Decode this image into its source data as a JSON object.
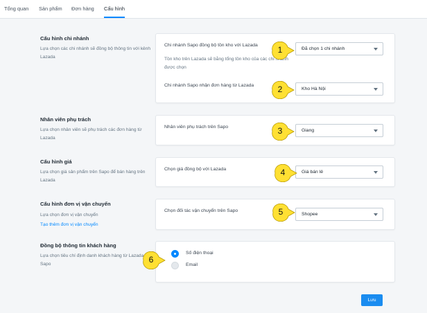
{
  "tabs": [
    {
      "label": "Tổng quan"
    },
    {
      "label": "Sản phẩm"
    },
    {
      "label": "Đơn hàng"
    },
    {
      "label": "Cấu hình"
    }
  ],
  "sections": {
    "branch": {
      "title": "Cấu hình chi nhánh",
      "desc": "Lựa chọn các chi nhánh sẽ đồng bộ thông tin với kênh Lazada",
      "field1_label": "Chi nhánh Sapo đồng bộ tồn kho với Lazada",
      "field1_note": "Tồn kho trên Lazada sẽ bằng tổng tồn kho của các chi nhánh được chọn",
      "field1_value": "Đã chọn 1 chi nhánh",
      "field2_label": "Chi nhánh Sapo nhận đơn hàng từ Lazada",
      "field2_value": "Kho Hà Nội"
    },
    "staff": {
      "title": "Nhân viên phụ trách",
      "desc": "Lựa chọn nhân viên sẽ phụ trách các đơn hàng từ Lazada",
      "field_label": "Nhân viên phụ trách trên Sapo",
      "field_value": "Giang"
    },
    "price": {
      "title": "Cấu hình giá",
      "desc": "Lựa chọn giá sản phẩm trên Sapo để bán hàng trên Lazada",
      "field_label": "Chọn giá đồng bộ với Lazada",
      "field_value": "Giá bán lẻ"
    },
    "shipping": {
      "title": "Cấu hình đơn vị vận chuyển",
      "desc": "Lựa chọn đơn vị vận chuyển",
      "link": "Tạo thêm đơn vị vận chuyển",
      "field_label": "Chọn đối tác vận chuyển trên Sapo",
      "field_value": "Shopee"
    },
    "customer": {
      "title": "Đồng bộ thông tin khách hàng",
      "desc": "Lựa chọn tiêu chí định danh khách hàng từ Lazada về Sapo",
      "option1": "Số điện thoại",
      "option2": "Email",
      "selected": "Số điện thoại"
    }
  },
  "callouts": [
    "1",
    "2",
    "3",
    "4",
    "5",
    "6"
  ],
  "save_label": "Lưu",
  "colors": {
    "accent": "#0088ff",
    "callout_fill": "#ffe033",
    "background": "#f4f6f8"
  }
}
